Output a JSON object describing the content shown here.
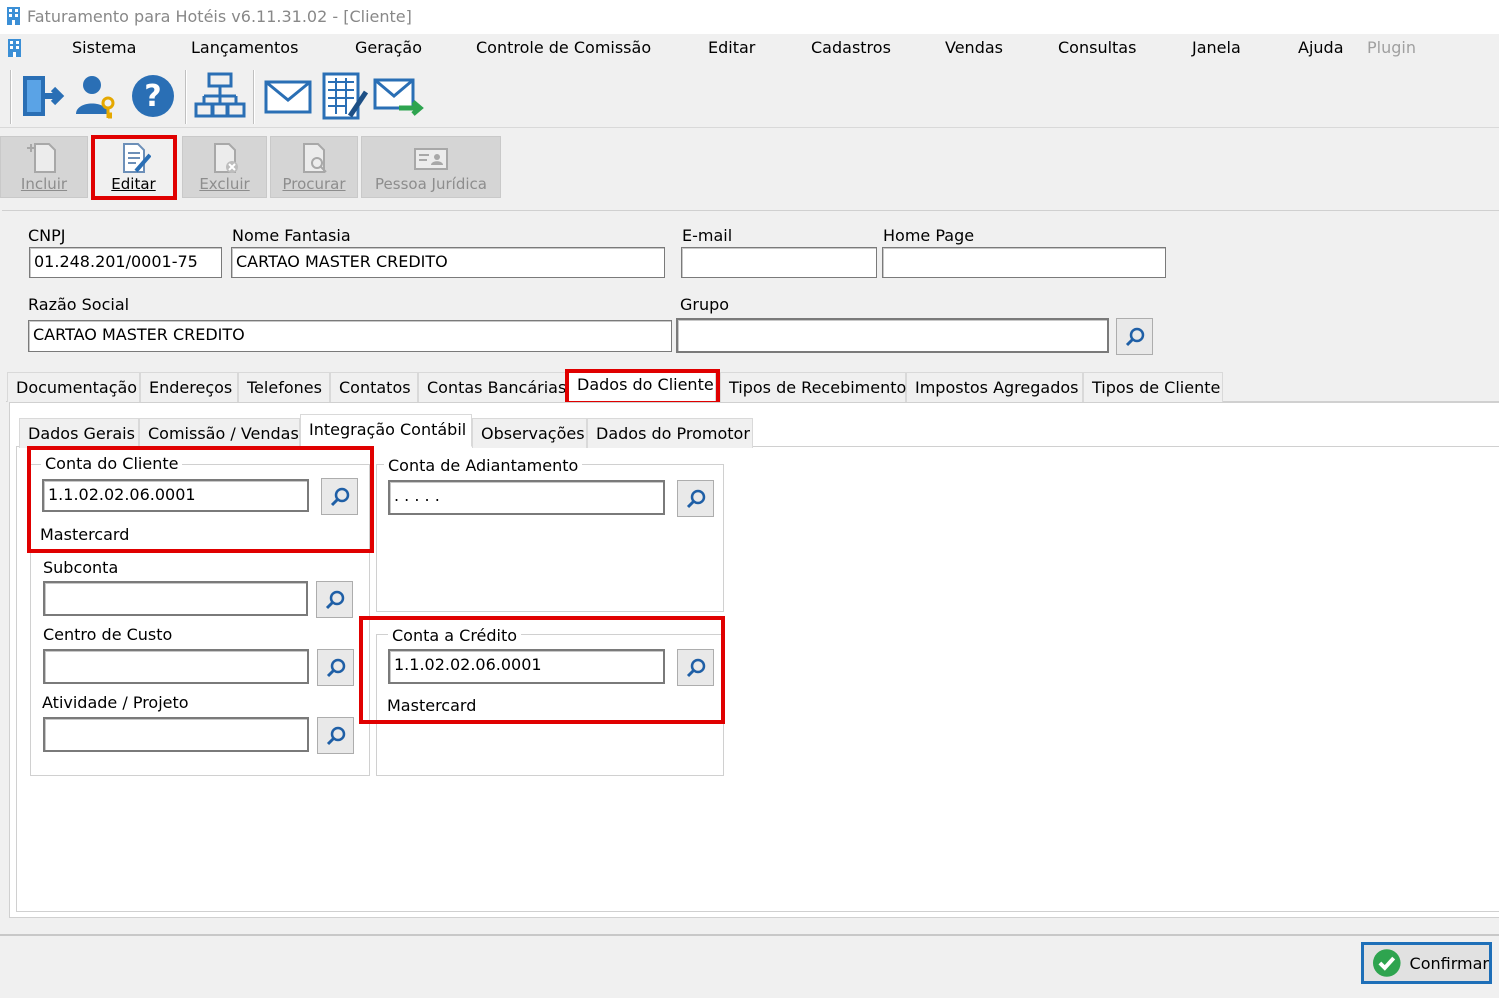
{
  "window": {
    "title": "Faturamento para Hotéis v6.11.31.02 - [Cliente]"
  },
  "menu": {
    "items": [
      "Sistema",
      "Lançamentos",
      "Geração",
      "Controle de Comissão",
      "Editar",
      "Cadastros",
      "Vendas",
      "Consultas",
      "Janela",
      "Ajuda"
    ],
    "plugin": "Plugin"
  },
  "toolbar": {
    "icons": [
      "exit-icon",
      "user-key-icon",
      "help-icon",
      "network-icon",
      "mail-icon",
      "invoice-edit-icon",
      "mail-send-icon"
    ]
  },
  "actions": {
    "incluir": "Incluir",
    "editar": "Editar",
    "excluir": "Excluir",
    "procurar": "Procurar",
    "pessoa_juridica": "Pessoa Jurídica"
  },
  "form": {
    "cnpj_label": "CNPJ",
    "cnpj_value": "01.248.201/0001-75",
    "nome_fantasia_label": "Nome Fantasia",
    "nome_fantasia_value": "CARTAO MASTER CREDITO",
    "email_label": "E-mail",
    "email_value": "",
    "home_page_label": "Home Page",
    "home_page_value": "",
    "razao_social_label": "Razão Social",
    "razao_social_value": "CARTAO MASTER CREDITO",
    "grupo_label": "Grupo",
    "grupo_value": ""
  },
  "main_tabs": [
    "Documentação",
    "Endereços",
    "Telefones",
    "Contatos",
    "Contas Bancárias",
    "Dados do Cliente",
    "Tipos de Recebimento",
    "Impostos Agregados",
    "Tipos de Cliente"
  ],
  "main_tab_selected": "Dados do Cliente",
  "sub_tabs": [
    "Dados Gerais",
    "Comissão / Vendas",
    "Integração Contábil",
    "Observações",
    "Dados do Promotor"
  ],
  "sub_tab_selected": "Integração Contábil",
  "integracao": {
    "conta_cliente_title": "Conta do Cliente",
    "conta_cliente_value": "1.1.02.02.06.0001",
    "conta_cliente_desc": "Mastercard",
    "subconta_label": "Subconta",
    "subconta_value": "",
    "centro_custo_label": "Centro de Custo",
    "centro_custo_value": "",
    "atividade_label": "Atividade / Projeto",
    "atividade_value": "",
    "conta_adiantamento_title": "Conta de Adiantamento",
    "conta_adiantamento_value": ". . . . .",
    "conta_credito_title": "Conta a Crédito",
    "conta_credito_value": "1.1.02.02.06.0001",
    "conta_credito_desc": "Mastercard"
  },
  "footer": {
    "confirm_label": "Confirmar"
  },
  "colors": {
    "highlight": "#e00000",
    "accent_blue": "#1e6fb8",
    "confirm_green": "#2ea44f"
  }
}
